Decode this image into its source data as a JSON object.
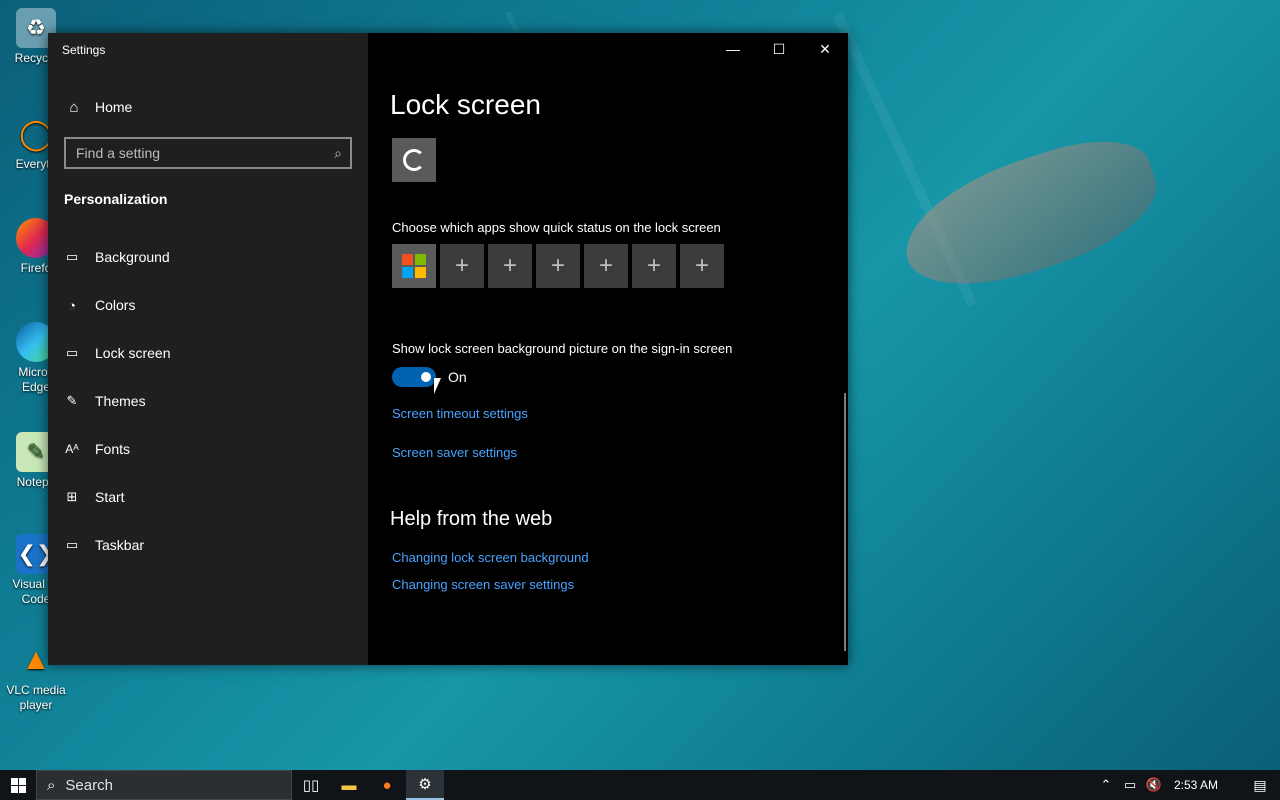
{
  "desktop": {
    "icons": [
      {
        "label": "Recycle",
        "glyph": "recycle-bin-icon"
      },
      {
        "label": "Everyth",
        "glyph": "everything-icon"
      },
      {
        "label": "Firefo",
        "glyph": "firefox-icon"
      },
      {
        "label": "Micros Edge",
        "glyph": "edge-icon"
      },
      {
        "label": "Notepa",
        "glyph": "notepad-icon"
      },
      {
        "label": "Visual St Code",
        "glyph": "vscode-icon"
      },
      {
        "label": "VLC media player",
        "glyph": "vlc-icon"
      }
    ]
  },
  "window": {
    "title": "Settings",
    "controls": {
      "minimize": "—",
      "maximize": "☐",
      "close": "✕"
    }
  },
  "sidebar": {
    "home_label": "Home",
    "search_placeholder": "Find a setting",
    "section_title": "Personalization",
    "items": [
      {
        "label": "Background",
        "icon": "image-icon"
      },
      {
        "label": "Colors",
        "icon": "palette-icon"
      },
      {
        "label": "Lock screen",
        "icon": "lock-screen-icon"
      },
      {
        "label": "Themes",
        "icon": "themes-icon"
      },
      {
        "label": "Fonts",
        "icon": "fonts-icon"
      },
      {
        "label": "Start",
        "icon": "start-icon"
      },
      {
        "label": "Taskbar",
        "icon": "taskbar-icon"
      }
    ]
  },
  "content": {
    "title": "Lock screen",
    "quick_status_label": "Choose which apps show quick status on the lock screen",
    "signin_label": "Show lock screen background picture on the sign-in screen",
    "toggle_state": "On",
    "link_timeout": "Screen timeout settings",
    "link_saver": "Screen saver settings",
    "help_title": "Help from the web",
    "help_links": [
      "Changing lock screen background",
      "Changing screen saver settings"
    ],
    "add_glyph": "+"
  },
  "taskbar": {
    "search_placeholder": "Search",
    "clock": "2:53 AM"
  },
  "colors": {
    "accent": "#0063b1",
    "link": "#4aa3ff",
    "sidebar_bg": "#1f1f1f",
    "content_bg": "#000000"
  }
}
